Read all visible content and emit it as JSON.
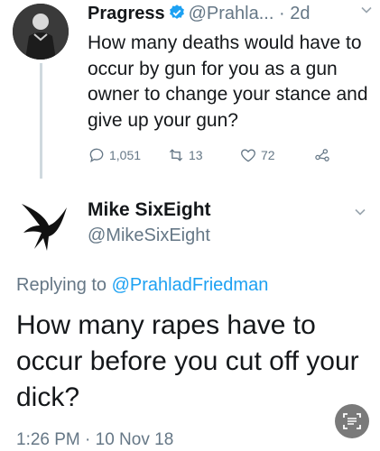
{
  "tweet1": {
    "display_name": "Pragress",
    "handle": "@Prahla...",
    "separator": "·",
    "time": "2d",
    "text": "How many deaths would have to occur by gun for you as a gun owner to change your stance and give up your gun?",
    "reply_count": "1,051",
    "retweet_count": "13",
    "like_count": "72"
  },
  "tweet2": {
    "display_name": "Mike SixEight",
    "handle": "@MikeSixEight",
    "replying_prefix": "Replying to",
    "replying_handle": "@PrahladFriedman",
    "text": "How many rapes have to occur before you cut off your dick?",
    "timestamp": "1:26 PM · 10 Nov 18"
  },
  "colors": {
    "verified_blue": "#1da1f2",
    "muted_gray": "#657786",
    "link_blue": "#1da1f2"
  },
  "icons": [
    "verified-badge-icon",
    "chevron-down-icon",
    "reply-icon",
    "retweet-icon",
    "like-icon",
    "share-icon",
    "raven-icon",
    "scan-text-icon"
  ]
}
